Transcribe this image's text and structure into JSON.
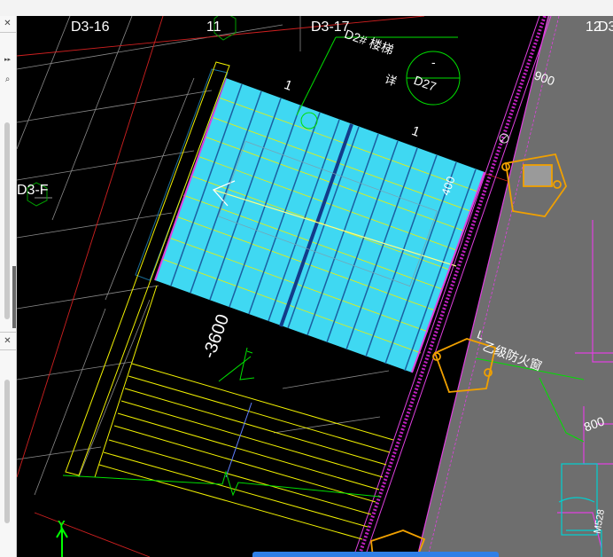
{
  "panel": {
    "close_glyph_top": "✕",
    "expand_glyph": "▸▸",
    "search_glyph": "⌕",
    "close_glyph_bottom": "✕"
  },
  "drawing": {
    "grid_labels": {
      "d3_16": "D3-16",
      "g11": "11",
      "d3_17": "D3-17",
      "g12": "12",
      "d3": "D3",
      "d3_f": "D3-F"
    },
    "stair_title": "D2# 楼梯",
    "detail_char": "详",
    "detail_ref": "D27",
    "dash_mark": "-",
    "dim_900": "900",
    "dim_400": "400",
    "dim_800": "800",
    "elevation": "-3600",
    "window_note": "乙级防火窗",
    "window_prefix": "L",
    "tag_1a": "1",
    "tag_1b": "1",
    "code_vert": "M528",
    "axis_y": "Y"
  },
  "colors": {
    "background": "#000000",
    "slab_fill": "#3fd8f2",
    "grid_lines": "#f0f000",
    "leader_green": "#00e000",
    "wall_magenta": "#e040e0",
    "dim_red": "#d02020",
    "concrete_grey": "#6e6e6e",
    "window_orange": "#f0a000"
  }
}
